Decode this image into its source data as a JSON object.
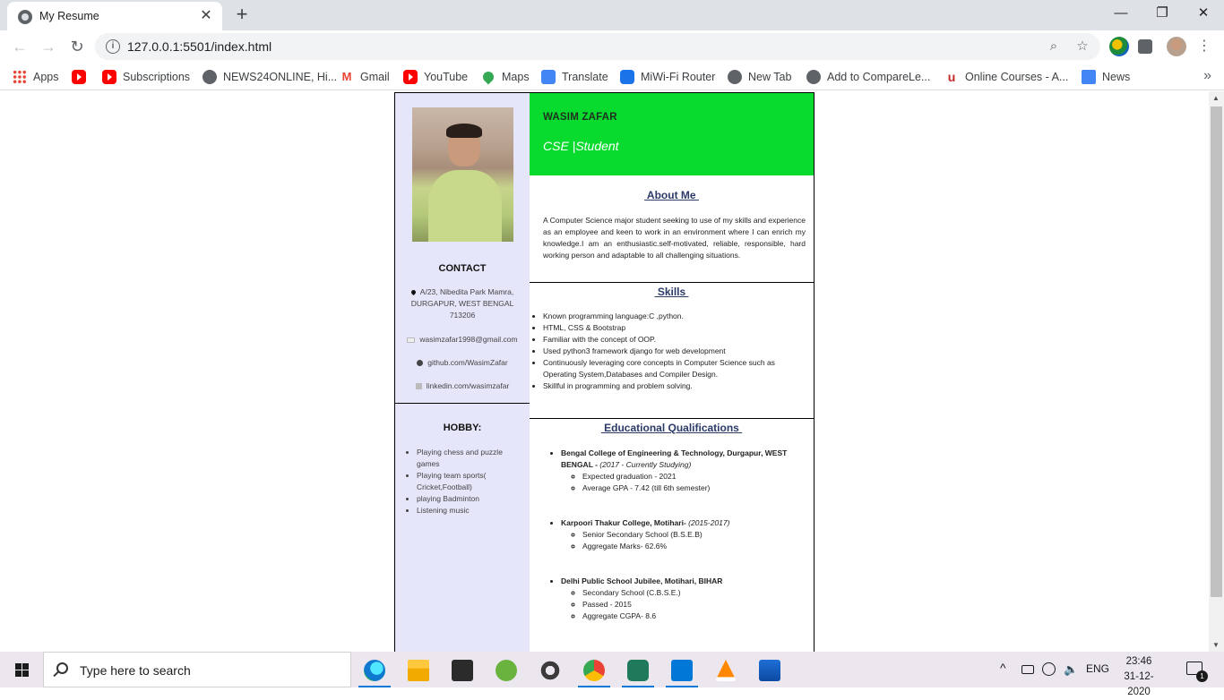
{
  "browser": {
    "tab_title": "My Resume",
    "tab_close": "✕",
    "new_tab": "+",
    "window_controls": {
      "minimize": "—",
      "restore": "❐",
      "close": "✕"
    },
    "nav": {
      "back": "←",
      "forward": "→",
      "reload": "↻"
    },
    "url": "127.0.0.1:5501/index.html",
    "omnibox_icons": {
      "zoom": "⌕",
      "star": "☆"
    },
    "menu": "⋮",
    "bookmarks": [
      {
        "label": "Apps",
        "icon": "apps-icon"
      },
      {
        "label": "",
        "icon": "youtube-icon"
      },
      {
        "label": "Subscriptions",
        "icon": "youtube-icon"
      },
      {
        "label": "NEWS24ONLINE, Hi...",
        "icon": "globe-icon"
      },
      {
        "label": "Gmail",
        "icon": "gmail-icon"
      },
      {
        "label": "YouTube",
        "icon": "youtube-icon"
      },
      {
        "label": "Maps",
        "icon": "maps-icon"
      },
      {
        "label": "Translate",
        "icon": "translate-icon"
      },
      {
        "label": "MiWi-Fi Router",
        "icon": "wifi-icon"
      },
      {
        "label": "New Tab",
        "icon": "globe-icon"
      },
      {
        "label": "Add to CompareLe...",
        "icon": "globe-icon"
      },
      {
        "label": "Online Courses - A...",
        "icon": "udemy-icon"
      },
      {
        "label": "News",
        "icon": "news-icon"
      }
    ],
    "bookmarks_more": "»"
  },
  "resume": {
    "name": "WASIM ZAFAR",
    "subtitle": "CSE |Student",
    "contact": {
      "title": "CONTACT",
      "address": "A/23, Nibedita Park Mamra, DURGAPUR, WEST BENGAL 713206",
      "email": "wasimzafar1998@gmail.com",
      "github": "github.com/WasimZafar",
      "linkedin": "linkedin.com/wasimzafar"
    },
    "hobby": {
      "title": "HOBBY:",
      "items": [
        "Playing chess and puzzle games",
        "Playing team sports( Cricket,Football)",
        "playing Badminton",
        "Listening music"
      ]
    },
    "about": {
      "title": " About Me ",
      "text": "A Computer Science major student seeking to use of my skills and experience as an employee and keen to work in an environment where I can enrich my knowledge.I am an enthusiastic.self-motivated, reliable, responsible, hard working person and adaptable to all challenging situations."
    },
    "skills": {
      "title": " Skills ",
      "items": [
        "Known programming language:C ,python.",
        "HTML, CSS & Bootstrap",
        "Familiar with the concept of OOP.",
        "Used python3 framework django for web development",
        "Continuously leveraging core concepts in Computer Science such as Operating System,Databases and Compiler Design.",
        "Skillful in programming and problem solving."
      ]
    },
    "education": {
      "title": " Educational Qualifications ",
      "entries": [
        {
          "institution": "Bengal College of Engineering & Technology, Durgapur, WEST BENGAL - ",
          "period": "(2017 - Currently Studying)",
          "details": [
            "Expected graduation - 2021",
            "Average GPA - 7.42 (till 6th semester)"
          ]
        },
        {
          "institution": "Karpoori Thakur College, Motihari- ",
          "period": "(2015-2017)",
          "details": [
            "Senior Secondary School (B.S.E.B)",
            "Aggregate Marks- 62.6%"
          ]
        },
        {
          "institution": "Delhi Public School Jubilee, Motihari, BIHAR",
          "period": "",
          "details": [
            "Secondary School (C.B.S.E.)",
            "Passed - 2015",
            "Aggregate CGPA- 8.6"
          ]
        }
      ]
    }
  },
  "taskbar": {
    "search_placeholder": "Type here to search",
    "apps": [
      "edge-icon",
      "file-explorer-icon",
      "store-icon",
      "utorrent-icon",
      "settings-icon",
      "chrome-icon",
      "whatsapp-icon",
      "vscode-icon",
      "vlc-icon",
      "photos-icon"
    ],
    "tray": {
      "chevron": "^",
      "language": "ENG"
    },
    "time": "23:46",
    "date": "31-12-2020",
    "notification_count": "1"
  },
  "colors": {
    "banner": "#08db2e",
    "sidebar": "#e6e6fa",
    "heading": "#2b3a67"
  }
}
